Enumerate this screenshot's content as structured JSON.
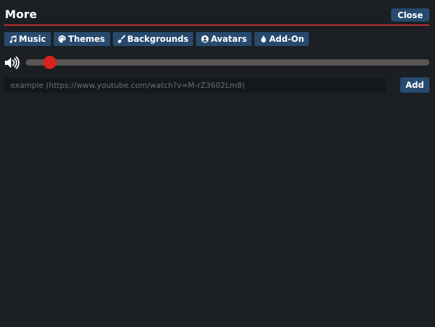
{
  "window": {
    "title": "More",
    "close_label": "Close"
  },
  "tabs": [
    {
      "label": "Music",
      "icon": "music-icon"
    },
    {
      "label": "Themes",
      "icon": "palette-icon"
    },
    {
      "label": "Backgrounds",
      "icon": "paintbrush-icon"
    },
    {
      "label": "Avatars",
      "icon": "user-circle-icon"
    },
    {
      "label": "Add-On",
      "icon": "drop-icon"
    }
  ],
  "volume": {
    "icon": "volume-icon",
    "level": 0.03
  },
  "url_input": {
    "value": "",
    "placeholder": "example (https://www.youtube.com/watch?v=M-rZ3602Lm8)"
  },
  "add_label": "Add",
  "colors": {
    "background": "#1b1f23",
    "accent": "#274a6e",
    "divider": "#c0302f",
    "slider_thumb": "#d8231f",
    "slider_track": "#5a5455"
  }
}
